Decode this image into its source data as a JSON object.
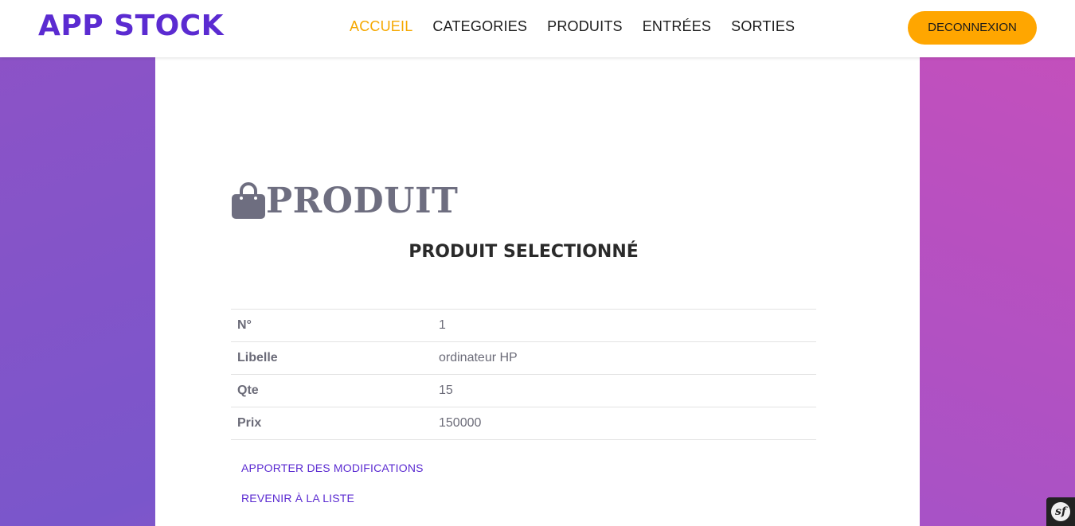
{
  "brand": "APP STOCK",
  "nav": {
    "items": [
      {
        "label": "ACCUEIL",
        "active": true
      },
      {
        "label": "CATEGORIES",
        "active": false
      },
      {
        "label": "PRODUITS",
        "active": false
      },
      {
        "label": "ENTRÉES",
        "active": false
      },
      {
        "label": "SORTIES",
        "active": false
      }
    ]
  },
  "logout_label": "DECONNEXION",
  "page": {
    "heading": "PRODUIT",
    "heading_icon": "shopping-bag-icon",
    "subtitle": "PRODUIT SELECTIONNÉ"
  },
  "details": [
    {
      "key": "N°",
      "value": "1"
    },
    {
      "key": "Libelle",
      "value": "ordinateur HP"
    },
    {
      "key": "Qte",
      "value": "15"
    },
    {
      "key": "Prix",
      "value": "150000"
    }
  ],
  "actions": {
    "edit_label": "APPORTER DES MODIFICATIONS",
    "back_label": "REVENIR À LA LISTE"
  },
  "debug_toolbar": {
    "icon": "symfony-icon",
    "label": "sf"
  },
  "colors": {
    "brand": "#5b2bd1",
    "nav_active": "#f5a800",
    "logout_bg": "#ffa600",
    "heading": "#6e6e80"
  }
}
